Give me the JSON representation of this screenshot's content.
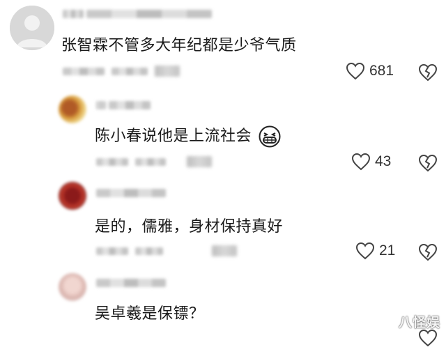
{
  "comments": [
    {
      "text": "张智霖不管多大年纪都是少爷气质",
      "likes": "681",
      "avatar": "default-avatar-icon"
    },
    {
      "text": "陈小春说他是上流社会",
      "likes": "43",
      "avatar": "user-avatar",
      "emoji": "grinning-face-icon"
    },
    {
      "text": "是的，儒雅，身材保持真好",
      "likes": "21",
      "avatar": "user-avatar"
    },
    {
      "text": "吴卓羲是保镖？",
      "likes": "",
      "avatar": "user-avatar"
    }
  ],
  "watermark": "八怪娱",
  "colors": {
    "meta": "#c0c0c0",
    "text": "#1a1a1a"
  }
}
